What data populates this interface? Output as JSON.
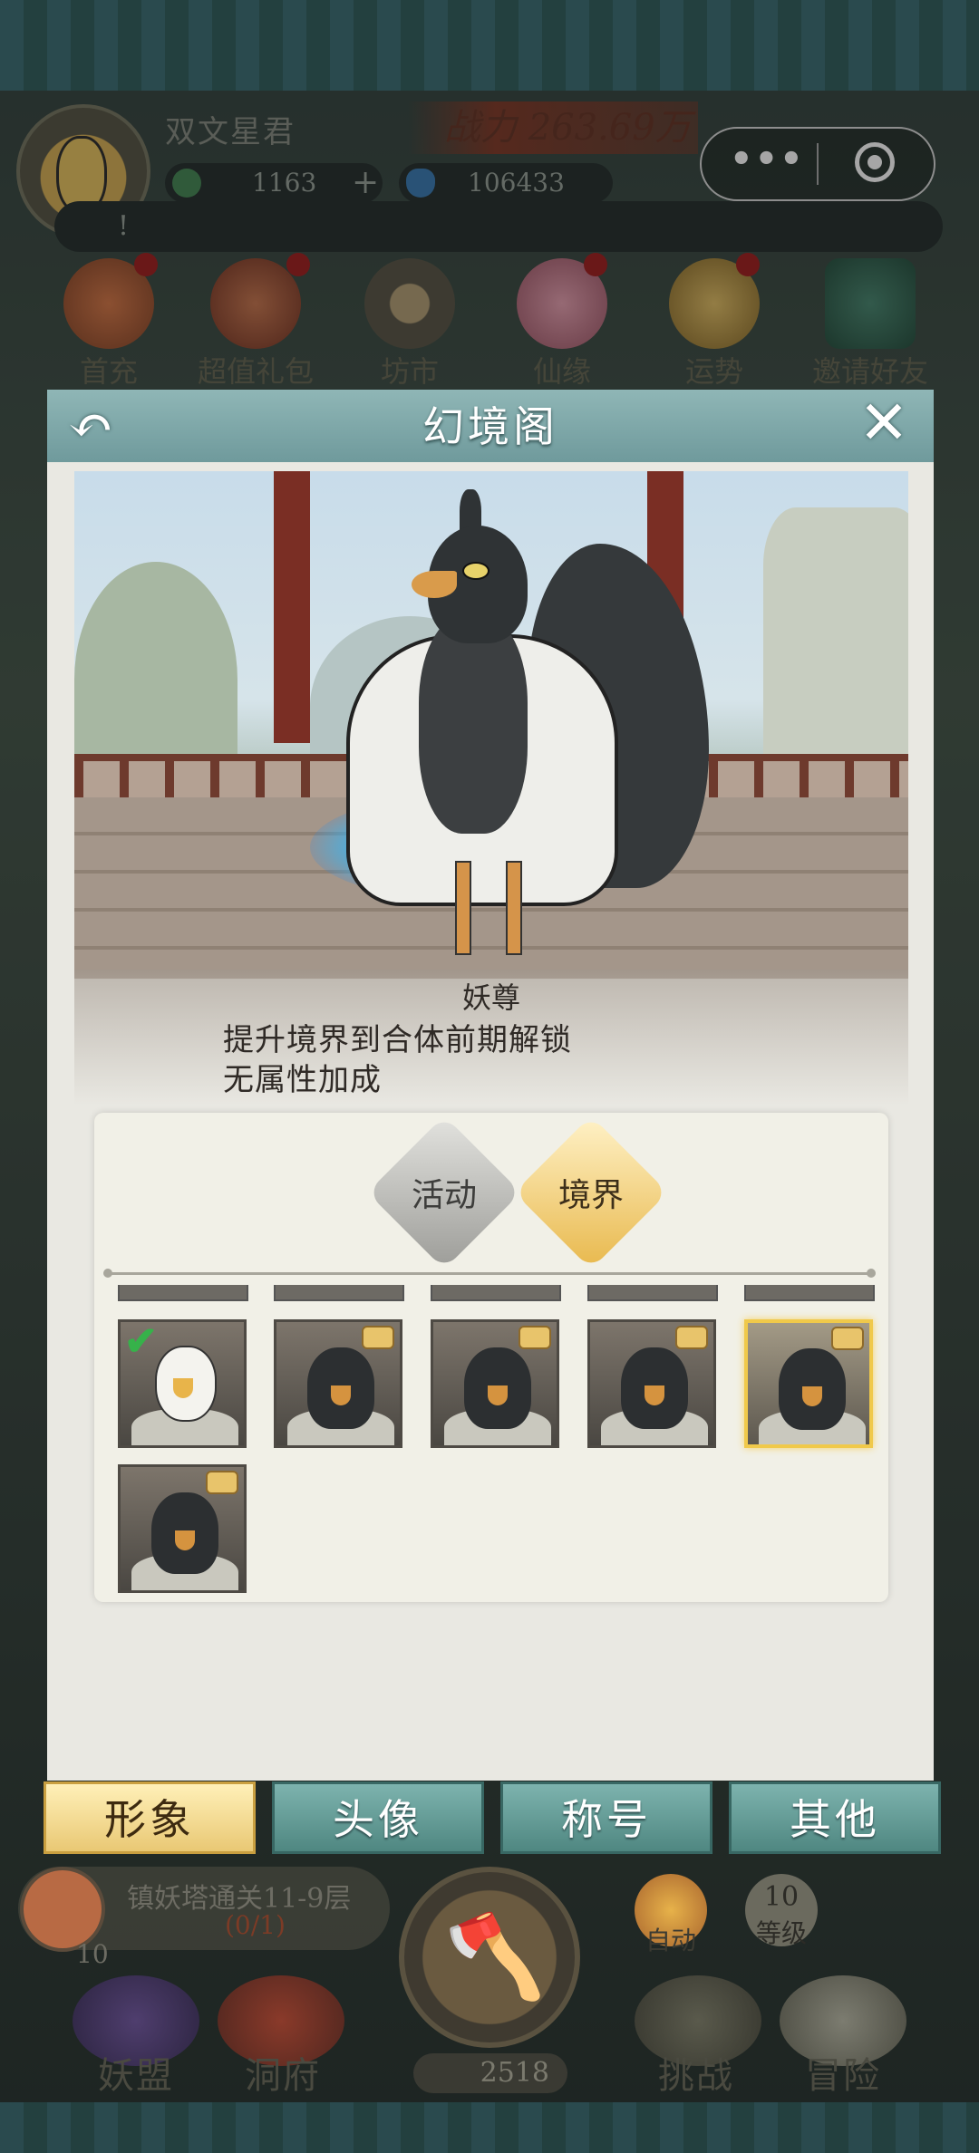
{
  "header": {
    "player_name": "双文星君",
    "power_label": "战力 263.69万",
    "currency1": "1163",
    "currency1_plus": "+",
    "currency2": "106433",
    "notice": "!",
    "capsule_more": "•••"
  },
  "top_icons": [
    {
      "label": "首充"
    },
    {
      "label": "超值礼包"
    },
    {
      "label": "坊市"
    },
    {
      "label": "仙缘"
    },
    {
      "label": "运势"
    },
    {
      "label": "邀请好友"
    }
  ],
  "panel": {
    "title": "幻境阁",
    "back_glyph": "↶",
    "close_glyph": "✕",
    "form_name": "妖尊",
    "unlock_text": "提升境界到合体前期解锁",
    "attr_text": "无属性加成",
    "categories": [
      {
        "label": "活动",
        "selected": false
      },
      {
        "label": "境界",
        "selected": true
      }
    ],
    "tiles": [
      {
        "state": "equipped"
      },
      {
        "state": "locked"
      },
      {
        "state": "locked"
      },
      {
        "state": "locked"
      },
      {
        "state": "locked",
        "selected": true
      },
      {
        "state": "locked"
      }
    ]
  },
  "bottom_tabs": [
    {
      "label": "形象",
      "active": true
    },
    {
      "label": "头像",
      "active": false
    },
    {
      "label": "称号",
      "active": false
    },
    {
      "label": "其他",
      "active": false
    }
  ],
  "hud": {
    "quest_text": "镇妖塔通关11-9层",
    "quest_progress": "(0/1)",
    "quest_level": "10",
    "auto_label": "自动",
    "level_num": "10",
    "level_label": "等级",
    "coins": "2518",
    "nav": [
      {
        "label": "妖盟"
      },
      {
        "label": "洞府"
      },
      {
        "label": "挑战"
      },
      {
        "label": "冒险"
      }
    ]
  },
  "colors": {
    "panel_header": "#7aa5a6",
    "active_tab": "#f2da8e",
    "inactive_tab": "#5f9892",
    "selected_border": "#f0c94a"
  }
}
